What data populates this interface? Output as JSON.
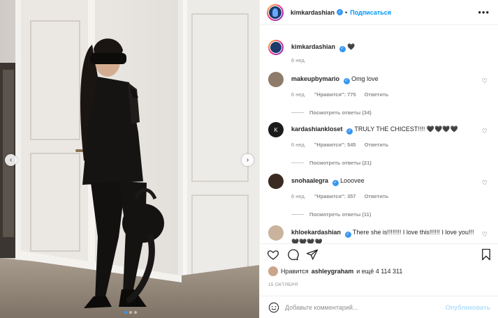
{
  "post": {
    "author": "kimkardashian",
    "follow_label": "Подписаться",
    "separator": "•",
    "caption_emoji": "🖤",
    "caption_time": "6 нед.",
    "more_label": "•••"
  },
  "carousel": {
    "slides": 3,
    "active": 0,
    "prev_glyph": "‹",
    "next_glyph": "›"
  },
  "comments": [
    {
      "user": "makeupbymario",
      "text": "Omg love",
      "time": "6 нед.",
      "likes": "\"Нравится\": 775",
      "reply": "Ответить",
      "replies": "Посмотреть ответы (34)"
    },
    {
      "user": "kardashiankloset",
      "text": "TRULY THE CHICEST!!!! 🖤🖤🖤🖤",
      "time": "6 нед.",
      "likes": "\"Нравится\": 545",
      "reply": "Ответить",
      "replies": "Посмотреть ответы (21)"
    },
    {
      "user": "snohaalegra",
      "text": "Looovee",
      "time": "6 нед.",
      "likes": "\"Нравится\": 357",
      "reply": "Ответить",
      "replies": "Посмотреть ответы (11)"
    },
    {
      "user": "khloekardashian",
      "text": "There she is!!!!!!!! I love this!!!!!! I love you!!! 🖤🖤🖤🖤"
    }
  ],
  "likes": {
    "prefix": "Нравится",
    "user": "ashleygraham",
    "suffix": "и ещё 4 114 311"
  },
  "date": "15 ОКТЯБРЯ",
  "add_comment": {
    "placeholder": "Добавьте комментарий...",
    "publish_label": "Опубликовать"
  },
  "colors": {
    "accent": "#0095f6",
    "verified": "#3897f0",
    "muted": "#8e8e8e"
  }
}
